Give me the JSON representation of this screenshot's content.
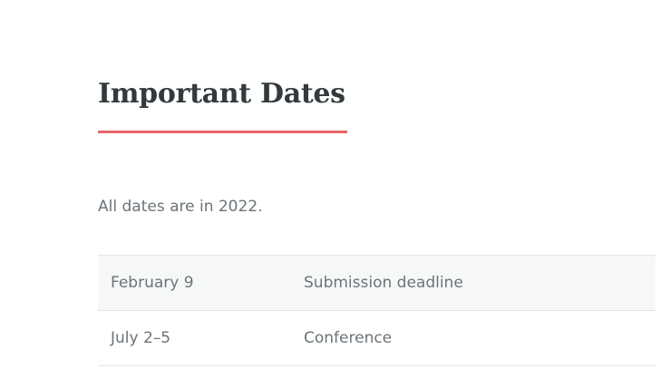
{
  "section": {
    "title": "Important Dates",
    "note": "All dates are in 2022."
  },
  "dates": [
    {
      "date": "February 9",
      "event": "Submission deadline"
    },
    {
      "date": "July 2–5",
      "event": "Conference"
    }
  ],
  "colors": {
    "accent": "#e8666a",
    "heading": "#333a3d",
    "text": "#6b7478",
    "row_shade": "#f6f8f8",
    "border": "#e2e5e6"
  }
}
